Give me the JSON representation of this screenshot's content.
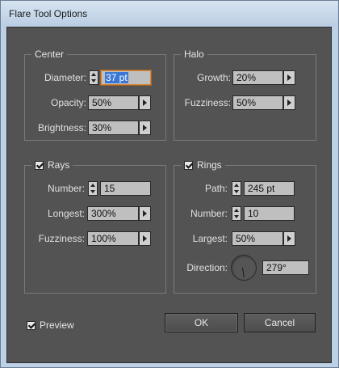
{
  "window": {
    "title": "Flare Tool Options"
  },
  "center": {
    "legend": "Center",
    "diameter_label": "Diameter:",
    "diameter_value": "37 pt",
    "opacity_label": "Opacity:",
    "opacity_value": "50%",
    "brightness_label": "Brightness:",
    "brightness_value": "30%"
  },
  "halo": {
    "legend": "Halo",
    "growth_label": "Growth:",
    "growth_value": "20%",
    "fuzziness_label": "Fuzziness:",
    "fuzziness_value": "50%"
  },
  "rays": {
    "legend": "Rays",
    "checked": true,
    "number_label": "Number:",
    "number_value": "15",
    "longest_label": "Longest:",
    "longest_value": "300%",
    "fuzziness_label": "Fuzziness:",
    "fuzziness_value": "100%"
  },
  "rings": {
    "legend": "Rings",
    "checked": true,
    "path_label": "Path:",
    "path_value": "245 pt",
    "number_label": "Number:",
    "number_value": "10",
    "largest_label": "Largest:",
    "largest_value": "50%",
    "direction_label": "Direction:",
    "direction_value": "279°"
  },
  "footer": {
    "preview_label": "Preview",
    "preview_checked": true,
    "ok_label": "OK",
    "cancel_label": "Cancel"
  },
  "colors": {
    "panel": "#535353",
    "field": "#bfbfbf",
    "selection": "#3a77d6",
    "focus": "#d8873a"
  },
  "icons": {
    "spinner": "spinner-arrows-icon",
    "popup": "triangle-right-icon",
    "dial": "angle-dial-icon",
    "check": "checkmark-icon"
  }
}
